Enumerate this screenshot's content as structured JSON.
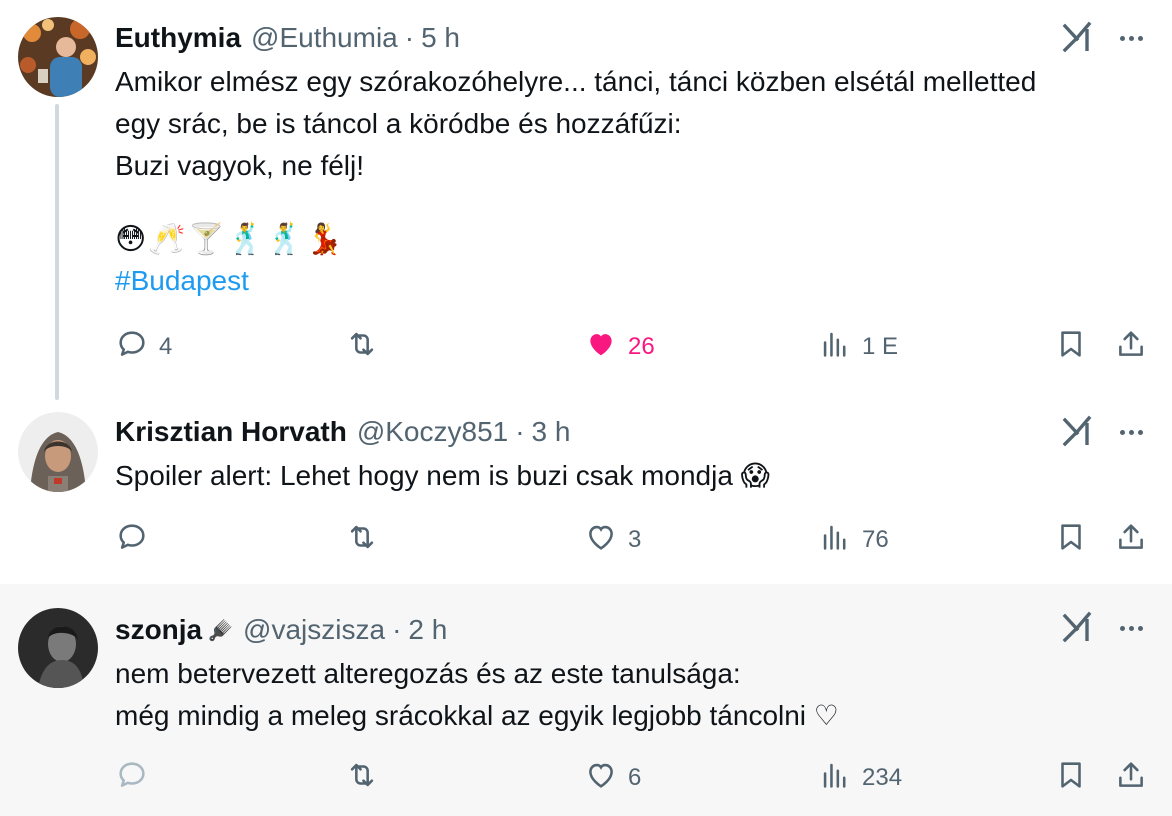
{
  "tweets": [
    {
      "name": "Euthymia",
      "handle": "@Euthumia",
      "dot": "·",
      "time": "5 h",
      "lines": [
        "Amikor elmész egy szórakozóhelyre... tánci, tánci közben elsétál melletted",
        "egy srác, be is táncol a köródbe és hozzáfűzi:",
        "Buzi vagyok, ne félj!"
      ],
      "emojis": "😳🥂🍸🕺🕺💃",
      "hashtag": "#Budapest",
      "replies": "4",
      "retweets": "",
      "likes": "26",
      "views": "1 E",
      "liked": true
    },
    {
      "name": "Krisztian Horvath",
      "handle": "@Koczy851",
      "dot": "·",
      "time": "3 h",
      "lines": [
        "Spoiler alert: Lehet hogy nem is buzi csak mondja 😱"
      ],
      "replies": "",
      "retweets": "",
      "likes": "3",
      "views": "76",
      "liked": false
    },
    {
      "name": "szonja",
      "name_emoji": "🪮",
      "handle": "@vajszisza",
      "dot": "·",
      "time": "2 h",
      "lines": [
        "nem betervezett alteregozás és az este tanulsága:",
        "még mindig a meleg srácokkal az egyik legjobb táncolni ♡"
      ],
      "replies": "",
      "retweets": "",
      "likes": "6",
      "views": "234",
      "liked": false
    }
  ],
  "colors": {
    "text": "#0f1419",
    "secondary": "#536471",
    "link": "#1d9bf0",
    "like": "#f91880",
    "thread_line": "#cfd9de",
    "highlight_bg": "#f7f7f7"
  },
  "icons": {
    "reply": "reply-icon",
    "retweet": "retweet-icon",
    "like": "heart-icon",
    "views": "views-icon",
    "bookmark": "bookmark-icon",
    "share": "share-icon",
    "grok": "grok-icon",
    "more": "more-icon"
  }
}
